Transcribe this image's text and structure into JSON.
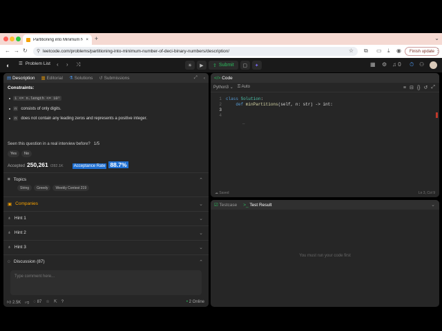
{
  "browser": {
    "tab_title": "Partitioning into Minimum N...",
    "url": "leetcode.com/problems/partitioning-into-minimum-number-of-deci-binary-numbers/description/",
    "finish_update": "Finish update"
  },
  "header": {
    "problem_list": "Problem List",
    "submit": "Submit",
    "notif_count": "0"
  },
  "left_panel": {
    "tabs": [
      "Description",
      "Editorial",
      "Solutions",
      "Submissions"
    ],
    "constraints_title": "Constraints:",
    "constraint_1_code": "1 <= n.length <= 10⁵",
    "constraint_2_code": "n",
    "constraint_2_text": "consists of only digits.",
    "constraint_3_code": "n",
    "constraint_3_text": "does not contain any leading zeros and represents a positive integer.",
    "seen_question": "Seen this question in a real interview before?",
    "seen_count": "1/5",
    "yes": "Yes",
    "no": "No",
    "accepted_label": "Accepted",
    "accepted_value": "250,261",
    "accepted_total": "/282.1K",
    "acceptance_rate_label": "Acceptance Rate",
    "acceptance_rate": "88.7%",
    "topics": "Topics",
    "tags": [
      "String",
      "Greedy",
      "Weekly Contest 219"
    ],
    "companies": "Companies",
    "hint1": "Hint 1",
    "hint2": "Hint 2",
    "hint3": "Hint 3",
    "discussion": "Discussion (87)",
    "comment_placeholder": "Type comment here...",
    "likes": "2.5K",
    "comments": "87",
    "online_count": "2",
    "online_label": "Online"
  },
  "code_panel": {
    "title": "Code",
    "language": "Python3",
    "mode": "Auto",
    "lines": [
      "class Solution:",
      "    def minPartitions(self, n: str) -> int:",
      "",
      ""
    ],
    "line_numbers": [
      "1",
      "2",
      "3",
      "4"
    ],
    "saved": "Saved",
    "cursor": "Ln 3, Col 9"
  },
  "test_panel": {
    "tab_testcase": "Testcase",
    "tab_result": "Test Result",
    "message": "You must run your code first"
  }
}
